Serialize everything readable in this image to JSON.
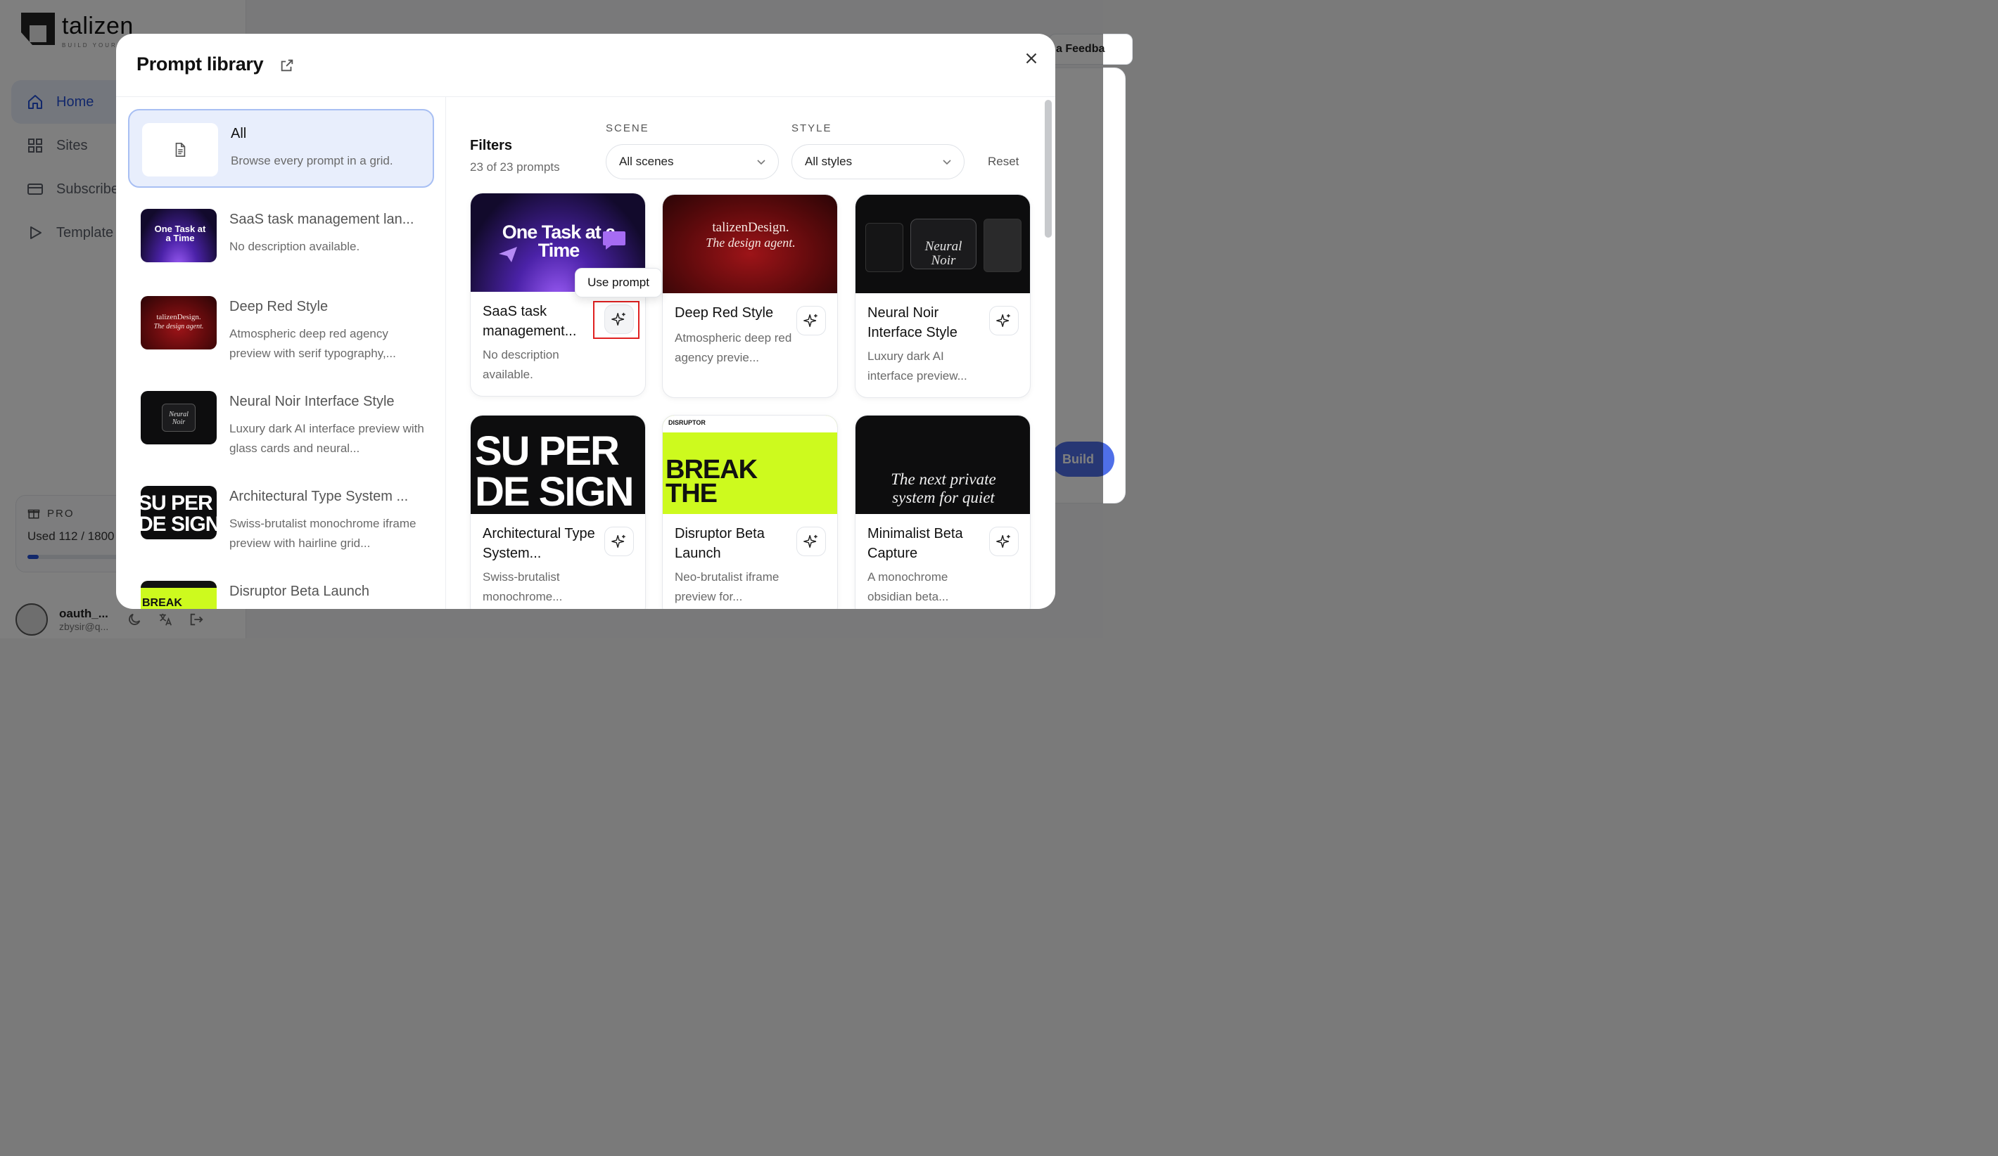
{
  "app": {
    "brand": "talizen",
    "tagline": "BUILD YOUR W",
    "nav": [
      {
        "label": "Home"
      },
      {
        "label": "Sites"
      },
      {
        "label": "Subscribe"
      },
      {
        "label": "Template"
      }
    ],
    "plan": {
      "name": "PRO",
      "usage": "Used 112 / 1800",
      "progress": 0.06
    },
    "user": {
      "name": "oauth_...",
      "email": "zbysir@q..."
    },
    "right_chip": "a Feedba",
    "build_label": "Build"
  },
  "modal": {
    "title": "Prompt library",
    "filters": {
      "label": "Filters",
      "count": "23 of 23 prompts",
      "scene_caption": "SCENE",
      "scene_value": "All scenes",
      "style_caption": "STYLE",
      "style_value": "All styles",
      "reset_label": "Reset"
    },
    "sidebar_items": [
      {
        "title": "All",
        "desc": "Browse every prompt in a grid."
      },
      {
        "title": "SaaS task management lan...",
        "desc": "No description available."
      },
      {
        "title": "Deep Red Style",
        "desc": "Atmospheric deep red agency preview with serif typography,..."
      },
      {
        "title": "Neural Noir Interface Style",
        "desc": "Luxury dark AI interface preview with glass cards and neural..."
      },
      {
        "title": "Architectural Type System ...",
        "desc": "Swiss-brutalist monochrome iframe preview with hairline grid..."
      },
      {
        "title": "Disruptor Beta Launch",
        "desc": ""
      }
    ],
    "cards": [
      {
        "title": "SaaS task management...",
        "desc": "No description available."
      },
      {
        "title": "Deep Red Style",
        "desc": "Atmospheric deep red agency previe..."
      },
      {
        "title": "Neural Noir Interface Style",
        "desc": "Luxury dark AI interface preview..."
      },
      {
        "title": "Architectural Type System...",
        "desc": "Swiss-brutalist monochrome..."
      },
      {
        "title": "Disruptor Beta Launch",
        "desc": "Neo-brutalist iframe preview for..."
      },
      {
        "title": "Minimalist Beta Capture",
        "desc": "A monochrome obsidian beta..."
      }
    ],
    "tooltip": "Use prompt",
    "thumbs": {
      "saas": "One Task at a Time",
      "red_1": "talizenDesign.",
      "red_2": "The design agent.",
      "noir_1": "Neural",
      "noir_2": "Noir",
      "arch_1": "SU PER",
      "arch_2": "DE SIGN",
      "disruptor_brand": "DISRUPTOR",
      "disruptor_1": "BREAK",
      "disruptor_2": "THE",
      "minimal_1": "The next private",
      "minimal_2": "system for quiet"
    }
  },
  "colors": {
    "accent": "#2450d6",
    "highlight": "#e02020",
    "lime": "#cdfa1e"
  }
}
